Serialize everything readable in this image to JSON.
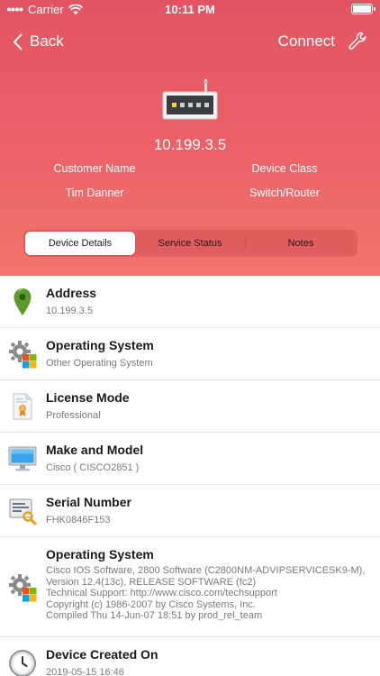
{
  "status_bar": {
    "carrier": "Carrier",
    "time": "10:11 PM"
  },
  "nav": {
    "back_label": "Back",
    "connect_label": "Connect"
  },
  "device": {
    "ip": "10.199.3.5",
    "customer_name_label": "Customer Name",
    "customer_name_value": "Tim Danner",
    "device_class_label": "Device Class",
    "device_class_value": "Switch/Router"
  },
  "tabs": [
    {
      "label": "Device Details",
      "active": true
    },
    {
      "label": "Service Status",
      "active": false
    },
    {
      "label": "Notes",
      "active": false
    }
  ],
  "details": [
    {
      "title": "Address",
      "value": "10.199.3.5",
      "icon": "map-pin-icon"
    },
    {
      "title": "Operating System",
      "value": "Other Operating System",
      "icon": "gear-windows-icon"
    },
    {
      "title": "License Mode",
      "value": "Professional",
      "icon": "certificate-icon"
    },
    {
      "title": "Make and Model",
      "value": "Cisco ( CISCO2851 )",
      "icon": "monitor-icon"
    },
    {
      "title": "Serial Number",
      "value": "FHK0846F153",
      "icon": "serial-search-icon"
    },
    {
      "title": "Operating System",
      "value": "Cisco IOS Software, 2800 Software (C2800NM-ADVIPSERVICESK9-M),\nVersion 12.4(13c), RELEASE SOFTWARE (fc2)\nTechnical Support: http://www.cisco.com/techsupport\nCopyright (c) 1986-2007 by Cisco Systems, Inc.\nCompiled Thu 14-Jun-07 18:51 by prod_rel_team",
      "icon": "gear-windows-icon"
    },
    {
      "title": "Device Created On",
      "value": "2019-05-15 16:46",
      "icon": "clock-icon"
    }
  ],
  "colors": {
    "header_top": "#e25463",
    "header_bottom": "#f3756c",
    "pin_green": "#5b9b2e"
  }
}
